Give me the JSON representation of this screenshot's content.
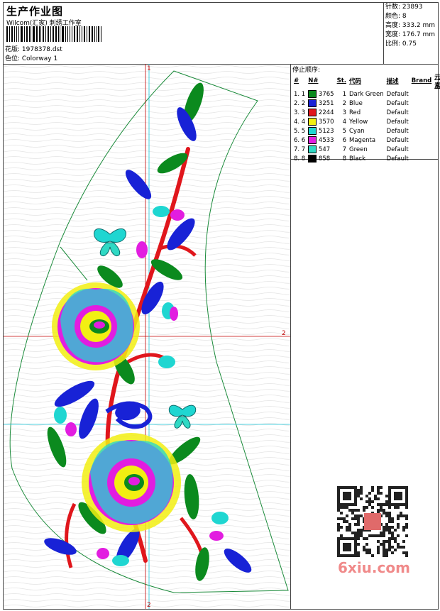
{
  "header": {
    "title": "生产作业图",
    "subtitle": "Wilcom(汇家) 刺绣工作室",
    "design_file_label": "花版: 1978378.dst",
    "colorway_label": "色位: Colorway 1"
  },
  "stats": {
    "stitches": "针数: 23893",
    "colors": "颜色: 8",
    "height": "高度: 333.2 mm",
    "width": "宽度: 176.7 mm",
    "scale": "比例: 0.75"
  },
  "stop_sequence": {
    "title": "停止顺序:",
    "headers": [
      "#",
      "N#",
      "St.",
      "代码",
      "描述",
      "Brand",
      "元素"
    ],
    "rows": [
      {
        "idx": "1. 1",
        "st": "3765",
        "code": "1",
        "desc": "Dark Green",
        "brand": "Default",
        "color": "#0b8a1e"
      },
      {
        "idx": "2. 2",
        "st": "3251",
        "code": "2",
        "desc": "Blue",
        "brand": "Default",
        "color": "#1822d6"
      },
      {
        "idx": "3. 3",
        "st": "2244",
        "code": "3",
        "desc": "Red",
        "brand": "Default",
        "color": "#e0161c"
      },
      {
        "idx": "4. 4",
        "st": "3570",
        "code": "4",
        "desc": "Yellow",
        "brand": "Default",
        "color": "#f2ef12"
      },
      {
        "idx": "5. 5",
        "st": "5123",
        "code": "5",
        "desc": "Cyan",
        "brand": "Default",
        "color": "#1fd6d1"
      },
      {
        "idx": "6. 6",
        "st": "4533",
        "code": "6",
        "desc": "Magenta",
        "brand": "Default",
        "color": "#e21de0"
      },
      {
        "idx": "7. 7",
        "st": "547",
        "code": "7",
        "desc": "Green",
        "brand": "Default",
        "color": "#2fd9c4"
      },
      {
        "idx": "8. 8",
        "st": "858",
        "code": "8",
        "desc": "Black",
        "brand": "Default",
        "color": "#000000"
      }
    ]
  },
  "design": {
    "axis_top": "1",
    "axis_right": "2",
    "axis_bottom": "2"
  },
  "watermark": "6xiu.com"
}
